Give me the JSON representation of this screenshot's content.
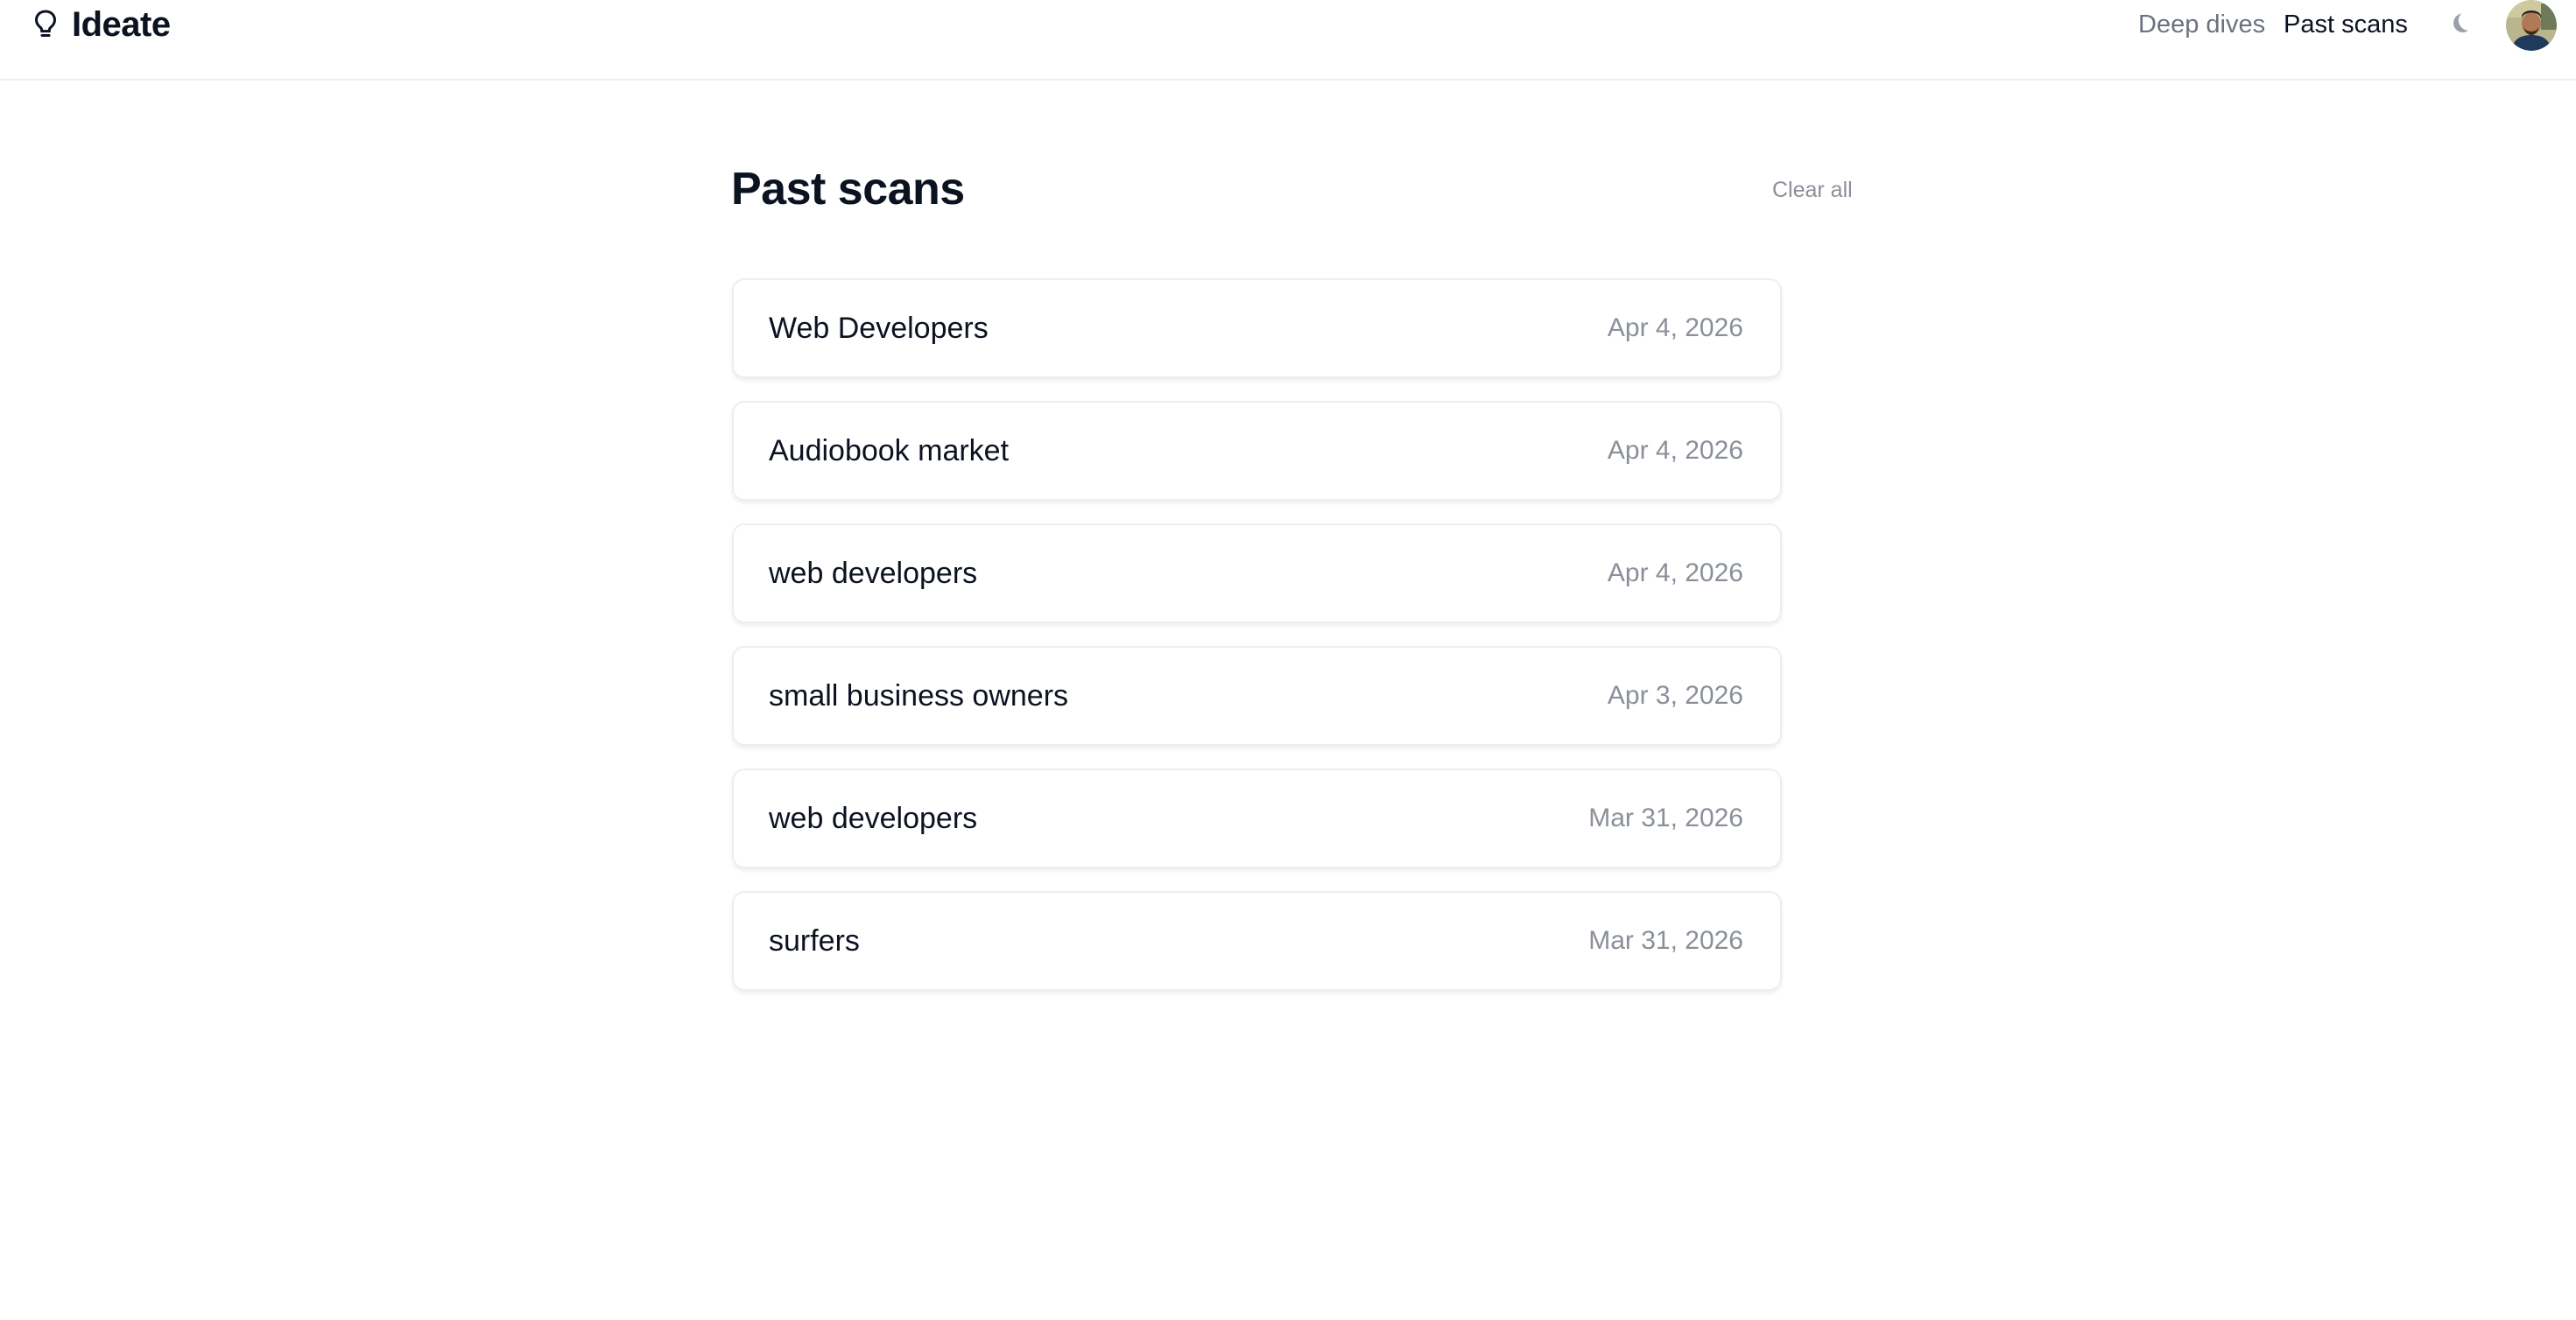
{
  "brand": {
    "name": "Ideate",
    "icon": "lightbulb-icon"
  },
  "nav": {
    "deep_dives": "Deep dives",
    "past_scans": "Past scans",
    "theme_toggle_icon": "moon-icon",
    "avatar": "user-avatar"
  },
  "main": {
    "title": "Past scans",
    "clear_all": "Clear all",
    "scans": [
      {
        "name": "Web Developers",
        "date": "Apr 4, 2026"
      },
      {
        "name": "Audiobook market",
        "date": "Apr 4, 2026"
      },
      {
        "name": "web developers",
        "date": "Apr 4, 2026"
      },
      {
        "name": "small business owners",
        "date": "Apr 3, 2026"
      },
      {
        "name": "web developers",
        "date": "Mar 31, 2026"
      },
      {
        "name": "surfers",
        "date": "Mar 31, 2026"
      }
    ]
  },
  "colors": {
    "text_primary": "#0b1220",
    "text_muted": "#8a8f99",
    "border": "#eceef1",
    "background": "#ffffff"
  }
}
